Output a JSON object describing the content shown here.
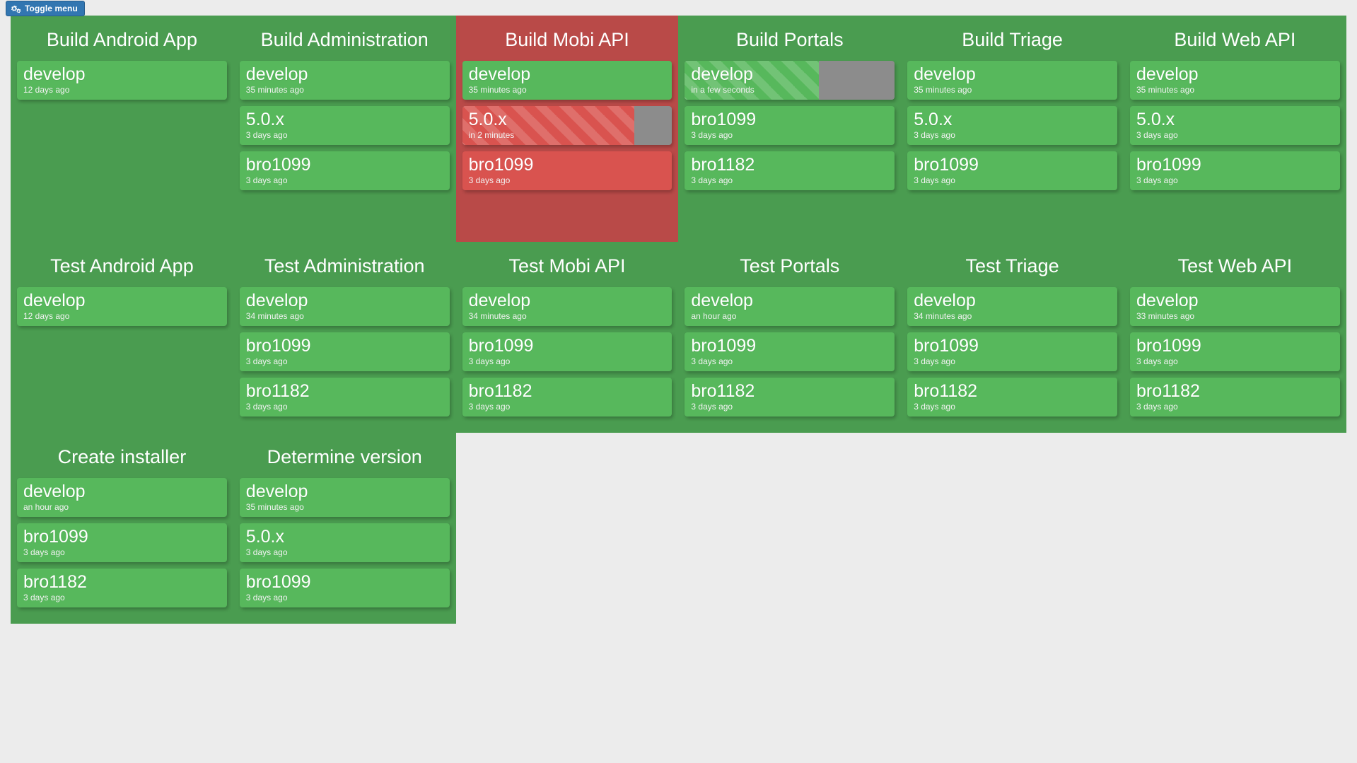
{
  "topbar": {
    "toggle_menu_label": "Toggle menu",
    "toggle_menu_icon": "cogs-icon"
  },
  "theme": {
    "page_background": "#ececec",
    "panel_success": "#4a9c50",
    "panel_failed": "#b94a48",
    "card_success": "#57b85c",
    "card_failed": "#d9534f",
    "progress_remaining": "#8c8c8c",
    "button_primary": "#3276b1",
    "text_primary": "#ffffff"
  },
  "rows": [
    {
      "row_name": "build-row",
      "panels": [
        {
          "title": "Build Android App",
          "status": "success",
          "cards": [
            {
              "branch": "develop",
              "time": "12 days ago",
              "status": "success",
              "running": false,
              "progress": null
            }
          ]
        },
        {
          "title": "Build Administration",
          "status": "success",
          "cards": [
            {
              "branch": "develop",
              "time": "35 minutes ago",
              "status": "success",
              "running": false,
              "progress": null
            },
            {
              "branch": "5.0.x",
              "time": "3 days ago",
              "status": "success",
              "running": false,
              "progress": null
            },
            {
              "branch": "bro1099",
              "time": "3 days ago",
              "status": "success",
              "running": false,
              "progress": null
            }
          ]
        },
        {
          "title": "Build Mobi API",
          "status": "failed",
          "cards": [
            {
              "branch": "develop",
              "time": "35 minutes ago",
              "status": "success",
              "running": false,
              "progress": null
            },
            {
              "branch": "5.0.x",
              "time": "in 2 minutes",
              "status": "failed",
              "running": true,
              "progress": 82
            },
            {
              "branch": "bro1099",
              "time": "3 days ago",
              "status": "failed",
              "running": false,
              "progress": null
            }
          ]
        },
        {
          "title": "Build Portals",
          "status": "success",
          "cards": [
            {
              "branch": "develop",
              "time": "in a few seconds",
              "status": "success",
              "running": true,
              "progress": 64
            },
            {
              "branch": "bro1099",
              "time": "3 days ago",
              "status": "success",
              "running": false,
              "progress": null
            },
            {
              "branch": "bro1182",
              "time": "3 days ago",
              "status": "success",
              "running": false,
              "progress": null
            }
          ]
        },
        {
          "title": "Build Triage",
          "status": "success",
          "cards": [
            {
              "branch": "develop",
              "time": "35 minutes ago",
              "status": "success",
              "running": false,
              "progress": null
            },
            {
              "branch": "5.0.x",
              "time": "3 days ago",
              "status": "success",
              "running": false,
              "progress": null
            },
            {
              "branch": "bro1099",
              "time": "3 days ago",
              "status": "success",
              "running": false,
              "progress": null
            }
          ]
        },
        {
          "title": "Build Web API",
          "status": "success",
          "cards": [
            {
              "branch": "develop",
              "time": "35 minutes ago",
              "status": "success",
              "running": false,
              "progress": null
            },
            {
              "branch": "5.0.x",
              "time": "3 days ago",
              "status": "success",
              "running": false,
              "progress": null
            },
            {
              "branch": "bro1099",
              "time": "3 days ago",
              "status": "success",
              "running": false,
              "progress": null
            }
          ]
        }
      ]
    },
    {
      "row_name": "test-row",
      "panels": [
        {
          "title": "Test Android App",
          "status": "success",
          "cards": [
            {
              "branch": "develop",
              "time": "12 days ago",
              "status": "success",
              "running": false,
              "progress": null
            }
          ]
        },
        {
          "title": "Test Administration",
          "status": "success",
          "cards": [
            {
              "branch": "develop",
              "time": "34 minutes ago",
              "status": "success",
              "running": false,
              "progress": null
            },
            {
              "branch": "bro1099",
              "time": "3 days ago",
              "status": "success",
              "running": false,
              "progress": null
            },
            {
              "branch": "bro1182",
              "time": "3 days ago",
              "status": "success",
              "running": false,
              "progress": null
            }
          ]
        },
        {
          "title": "Test Mobi API",
          "status": "success",
          "cards": [
            {
              "branch": "develop",
              "time": "34 minutes ago",
              "status": "success",
              "running": false,
              "progress": null
            },
            {
              "branch": "bro1099",
              "time": "3 days ago",
              "status": "success",
              "running": false,
              "progress": null
            },
            {
              "branch": "bro1182",
              "time": "3 days ago",
              "status": "success",
              "running": false,
              "progress": null
            }
          ]
        },
        {
          "title": "Test Portals",
          "status": "success",
          "cards": [
            {
              "branch": "develop",
              "time": "an hour ago",
              "status": "success",
              "running": false,
              "progress": null
            },
            {
              "branch": "bro1099",
              "time": "3 days ago",
              "status": "success",
              "running": false,
              "progress": null
            },
            {
              "branch": "bro1182",
              "time": "3 days ago",
              "status": "success",
              "running": false,
              "progress": null
            }
          ]
        },
        {
          "title": "Test Triage",
          "status": "success",
          "cards": [
            {
              "branch": "develop",
              "time": "34 minutes ago",
              "status": "success",
              "running": false,
              "progress": null
            },
            {
              "branch": "bro1099",
              "time": "3 days ago",
              "status": "success",
              "running": false,
              "progress": null
            },
            {
              "branch": "bro1182",
              "time": "3 days ago",
              "status": "success",
              "running": false,
              "progress": null
            }
          ]
        },
        {
          "title": "Test Web API",
          "status": "success",
          "cards": [
            {
              "branch": "develop",
              "time": "33 minutes ago",
              "status": "success",
              "running": false,
              "progress": null
            },
            {
              "branch": "bro1099",
              "time": "3 days ago",
              "status": "success",
              "running": false,
              "progress": null
            },
            {
              "branch": "bro1182",
              "time": "3 days ago",
              "status": "success",
              "running": false,
              "progress": null
            }
          ]
        }
      ]
    },
    {
      "row_name": "misc-row",
      "panels": [
        {
          "title": "Create installer",
          "status": "success",
          "cards": [
            {
              "branch": "develop",
              "time": "an hour ago",
              "status": "success",
              "running": false,
              "progress": null
            },
            {
              "branch": "bro1099",
              "time": "3 days ago",
              "status": "success",
              "running": false,
              "progress": null
            },
            {
              "branch": "bro1182",
              "time": "3 days ago",
              "status": "success",
              "running": false,
              "progress": null
            }
          ]
        },
        {
          "title": "Determine version",
          "status": "success",
          "cards": [
            {
              "branch": "develop",
              "time": "35 minutes ago",
              "status": "success",
              "running": false,
              "progress": null
            },
            {
              "branch": "5.0.x",
              "time": "3 days ago",
              "status": "success",
              "running": false,
              "progress": null
            },
            {
              "branch": "bro1099",
              "time": "3 days ago",
              "status": "success",
              "running": false,
              "progress": null
            }
          ]
        }
      ]
    }
  ]
}
